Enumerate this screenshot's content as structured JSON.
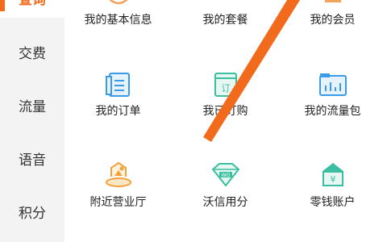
{
  "accent": "#f26b1d",
  "icon_blue": "#3b9be6",
  "sidebar": {
    "items": [
      {
        "label": "查询",
        "active": true
      },
      {
        "label": "交费",
        "active": false
      },
      {
        "label": "流量",
        "active": false
      },
      {
        "label": "语音",
        "active": false
      },
      {
        "label": "积分",
        "active": false
      }
    ]
  },
  "grid": {
    "rows": [
      [
        {
          "label": "我的基本信息",
          "icon": "user-info-icon"
        },
        {
          "label": "我的套餐",
          "icon": "package-icon"
        },
        {
          "label": "我的会员",
          "icon": "member-icon"
        }
      ],
      [
        {
          "label": "我的订单",
          "icon": "order-icon"
        },
        {
          "label": "我已订购",
          "icon": "subscribed-icon"
        },
        {
          "label": "我的流量包",
          "icon": "data-package-icon"
        }
      ],
      [
        {
          "label": "附近营业厅",
          "icon": "nearby-store-icon"
        },
        {
          "label": "沃信用分",
          "icon": "credit-score-icon"
        },
        {
          "label": "零钱账户",
          "icon": "wallet-icon"
        }
      ]
    ]
  },
  "icons": {
    "credit_badge": "WO",
    "wallet_symbol": "¥"
  }
}
